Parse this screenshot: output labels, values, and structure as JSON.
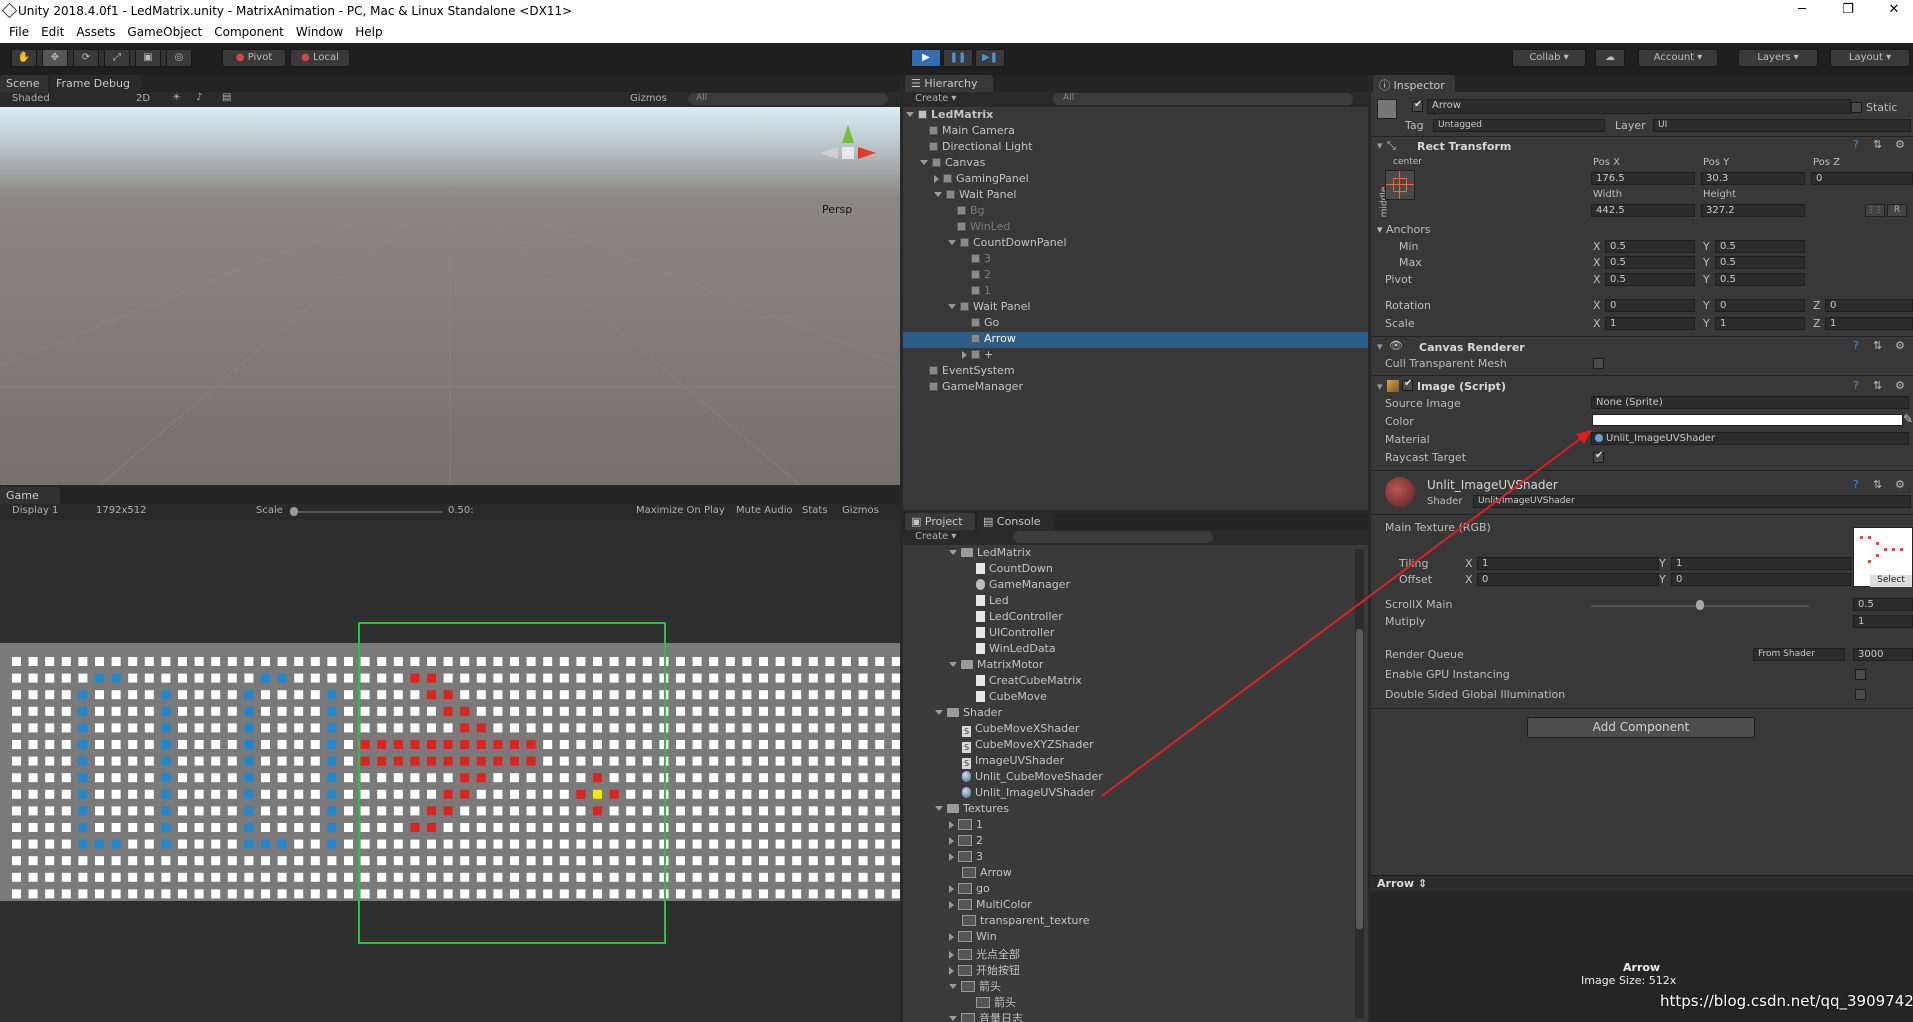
{
  "window": {
    "title": "Unity 2018.4.0f1 - LedMatrix.unity - MatrixAnimation - PC, Mac & Linux Standalone <DX11>",
    "min": "─",
    "max": "❐",
    "close": "✕"
  },
  "menu": [
    "File",
    "Edit",
    "Assets",
    "GameObject",
    "Component",
    "Window",
    "Help"
  ],
  "toolbar": {
    "pivot": "Pivot",
    "local": "Local",
    "collab": "Collab",
    "account": "Account",
    "layers": "Layers",
    "layout": "Layout"
  },
  "scene": {
    "tab_scene": "Scene",
    "tab_frame": "Frame Debug",
    "shaded": "Shaded",
    "mode2d": "2D",
    "gizmos": "Gizmos",
    "search": "All",
    "persp": "Persp"
  },
  "game": {
    "tab": "Game",
    "display": "Display 1",
    "resolution": "1792x512",
    "scale_label": "Scale",
    "scale_value": "0.50:",
    "max_on_play": "Maximize On Play",
    "mute": "Mute Audio",
    "stats": "Stats",
    "gizmos": "Gizmos"
  },
  "hierarchy": {
    "tab": "Hierarchy",
    "create": "Create",
    "search": "All",
    "items": [
      {
        "label": "LedMatrix",
        "depth": 0,
        "exp": "down",
        "bold": true
      },
      {
        "label": "Main Camera",
        "depth": 1
      },
      {
        "label": "Directional Light",
        "depth": 1
      },
      {
        "label": "Canvas",
        "depth": 1,
        "exp": "down"
      },
      {
        "label": "GamingPanel",
        "depth": 2,
        "exp": "right"
      },
      {
        "label": "Wait Panel",
        "depth": 2,
        "exp": "down"
      },
      {
        "label": "Bg",
        "depth": 3,
        "dim": true
      },
      {
        "label": "WinLed",
        "depth": 3,
        "dim": true
      },
      {
        "label": "CountDownPanel",
        "depth": 3,
        "exp": "down"
      },
      {
        "label": "3",
        "depth": 4,
        "dim": true
      },
      {
        "label": "2",
        "depth": 4,
        "dim": true
      },
      {
        "label": "1",
        "depth": 4,
        "dim": true
      },
      {
        "label": "Wait Panel",
        "depth": 3,
        "exp": "down"
      },
      {
        "label": "Go",
        "depth": 4
      },
      {
        "label": "Arrow",
        "depth": 4,
        "selected": true
      },
      {
        "label": "+",
        "depth": 4,
        "exp": "right"
      },
      {
        "label": "EventSystem",
        "depth": 1
      },
      {
        "label": "GameManager",
        "depth": 1
      }
    ]
  },
  "project": {
    "tab": "Project",
    "console": "Console",
    "create": "Create",
    "items": [
      {
        "label": "LedMatrix",
        "depth": 1,
        "icon": "folder",
        "exp": "down"
      },
      {
        "label": "CountDown",
        "depth": 2,
        "icon": "script"
      },
      {
        "label": "GameManager",
        "depth": 2,
        "icon": "gear"
      },
      {
        "label": "Led",
        "depth": 2,
        "icon": "script"
      },
      {
        "label": "LedController",
        "depth": 2,
        "icon": "script"
      },
      {
        "label": "UIController",
        "depth": 2,
        "icon": "script"
      },
      {
        "label": "WinLedData",
        "depth": 2,
        "icon": "script"
      },
      {
        "label": "MatrixMotor",
        "depth": 1,
        "icon": "folder",
        "exp": "down"
      },
      {
        "label": "CreatCubeMatrix",
        "depth": 2,
        "icon": "script"
      },
      {
        "label": "CubeMove",
        "depth": 2,
        "icon": "script"
      },
      {
        "label": "Shader",
        "depth": 0,
        "icon": "folder",
        "exp": "down"
      },
      {
        "label": "CubeMoveXShader",
        "depth": 1,
        "icon": "shader"
      },
      {
        "label": "CubeMoveXYZShader",
        "depth": 1,
        "icon": "shader"
      },
      {
        "label": "ImageUVShader",
        "depth": 1,
        "icon": "shader"
      },
      {
        "label": "Unlit_CubeMoveShader",
        "depth": 1,
        "icon": "material"
      },
      {
        "label": "Unlit_ImageUVShader",
        "depth": 1,
        "icon": "material"
      },
      {
        "label": "Textures",
        "depth": 0,
        "icon": "folder",
        "exp": "down"
      },
      {
        "label": "1",
        "depth": 1,
        "icon": "tex",
        "exp": "right"
      },
      {
        "label": "2",
        "depth": 1,
        "icon": "tex",
        "exp": "right"
      },
      {
        "label": "3",
        "depth": 1,
        "icon": "tex",
        "exp": "right"
      },
      {
        "label": "Arrow",
        "depth": 1,
        "icon": "tex"
      },
      {
        "label": "go",
        "depth": 1,
        "icon": "tex",
        "exp": "right"
      },
      {
        "label": "MultiColor",
        "depth": 1,
        "icon": "tex",
        "exp": "right"
      },
      {
        "label": "transparent_texture",
        "depth": 1,
        "icon": "tex"
      },
      {
        "label": "Win",
        "depth": 1,
        "icon": "tex",
        "exp": "right"
      },
      {
        "label": "光点全部",
        "depth": 1,
        "icon": "tex",
        "exp": "right"
      },
      {
        "label": "开始按钮",
        "depth": 1,
        "icon": "tex",
        "exp": "right"
      },
      {
        "label": "箭头",
        "depth": 1,
        "icon": "tex",
        "exp": "down"
      },
      {
        "label": "箭头",
        "depth": 2,
        "icon": "tex"
      },
      {
        "label": "音量日志",
        "depth": 1,
        "icon": "tex",
        "exp": "down"
      }
    ]
  },
  "inspector": {
    "tab": "Inspector",
    "name": "Arrow",
    "static": "Static",
    "tag_label": "Tag",
    "tag": "Untagged",
    "layer_label": "Layer",
    "layer": "UI",
    "rect": {
      "title": "Rect Transform",
      "center": "center",
      "middle": "middle",
      "posx_l": "Pos X",
      "posy_l": "Pos Y",
      "posz_l": "Pos Z",
      "posx": "176.5",
      "posy": "30.3",
      "posz": "0",
      "width_l": "Width",
      "height_l": "Height",
      "width": "442.5",
      "height": "327.2",
      "r": "R",
      "anchors": "Anchors",
      "min": "Min",
      "max": "Max",
      "pivot": "Pivot",
      "rotation": "Rotation",
      "scale": "Scale",
      "x": "X",
      "y": "Y",
      "z": "Z",
      "min_x": "0.5",
      "min_y": "0.5",
      "max_x": "0.5",
      "max_y": "0.5",
      "pivot_x": "0.5",
      "pivot_y": "0.5",
      "rot_x": "0",
      "rot_y": "0",
      "rot_z": "0",
      "scale_x": "1",
      "scale_y": "1",
      "scale_z": "1"
    },
    "canvas_renderer": {
      "title": "Canvas Renderer",
      "cull": "Cull Transparent Mesh"
    },
    "image": {
      "title": "Image (Script)",
      "source_l": "Source Image",
      "source": "None (Sprite)",
      "color_l": "Color",
      "material_l": "Material",
      "material": "Unlit_ImageUVShader",
      "raycast_l": "Raycast Target",
      "raycast_check": "✔"
    },
    "material": {
      "name": "Unlit_ImageUVShader",
      "shader_l": "Shader",
      "shader": "Unlit/ImageUVShader",
      "main_tex": "Main Texture (RGB)",
      "tiling": "Tiling",
      "offset": "Offset",
      "tiling_x": "1",
      "tiling_y": "1",
      "offset_x": "0",
      "offset_y": "0",
      "select": "Select",
      "scroll_l": "ScrollX Main",
      "scroll": "0.5",
      "scroll_frac": 0.5,
      "mutiply_l": "Mutiply",
      "mutiply": "1",
      "rq_l": "Render Queue",
      "rq_mode": "From Shader",
      "rq": "3000",
      "gpu": "Enable GPU Instancing",
      "dsgi": "Double Sided Global Illumination"
    },
    "add_component": "Add Component",
    "preview_label": "Arrow",
    "preview_name": "Arrow",
    "preview_size": "Image Size: 512x"
  },
  "watermark": "https://blog.csdn.net/qq_39097425",
  "colors": {
    "accent": "#2c5d87",
    "play": "#4a90d9",
    "led_blue": "#1e88d0",
    "led_red": "#e0221c",
    "led_yellow": "#ffe600",
    "green_rect": "#29c23a",
    "annotation": "#e02020"
  }
}
